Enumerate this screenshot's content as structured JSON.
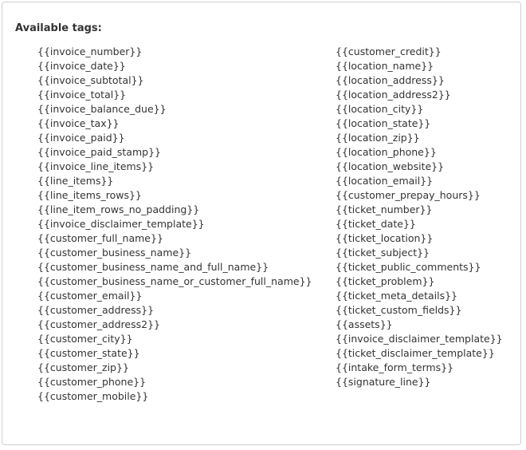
{
  "panel": {
    "title": "Available tags:"
  },
  "tags": {
    "left": [
      "{{invoice_number}}",
      "{{invoice_date}}",
      "{{invoice_subtotal}}",
      "{{invoice_total}}",
      "{{invoice_balance_due}}",
      "{{invoice_tax}}",
      "{{invoice_paid}}",
      "{{invoice_paid_stamp}}",
      "{{invoice_line_items}}",
      "{{line_items}}",
      "{{line_items_rows}}",
      "{{line_item_rows_no_padding}}",
      "{{invoice_disclaimer_template}}",
      "{{customer_full_name}}",
      "{{customer_business_name}}",
      "{{customer_business_name_and_full_name}}",
      "{{customer_business_name_or_customer_full_name}}",
      "{{customer_email}}",
      "{{customer_address}}",
      "{{customer_address2}}",
      "{{customer_city}}",
      "{{customer_state}}",
      "{{customer_zip}}",
      "{{customer_phone}}",
      "{{customer_mobile}}"
    ],
    "right": [
      "{{customer_credit}}",
      "{{location_name}}",
      "{{location_address}}",
      "{{location_address2}}",
      "{{location_city}}",
      "{{location_state}}",
      "{{location_zip}}",
      "{{location_phone}}",
      "{{location_website}}",
      "{{location_email}}",
      "{{customer_prepay_hours}}",
      "{{ticket_number}}",
      "{{ticket_date}}",
      "{{ticket_location}}",
      "{{ticket_subject}}",
      "{{ticket_public_comments}}",
      "{{ticket_problem}}",
      "{{ticket_meta_details}}",
      "{{ticket_custom_fields}}",
      "{{assets}}",
      "{{invoice_disclaimer_template}}",
      "{{ticket_disclaimer_template}}",
      "{{intake_form_terms}}",
      "{{signature_line}}"
    ]
  }
}
